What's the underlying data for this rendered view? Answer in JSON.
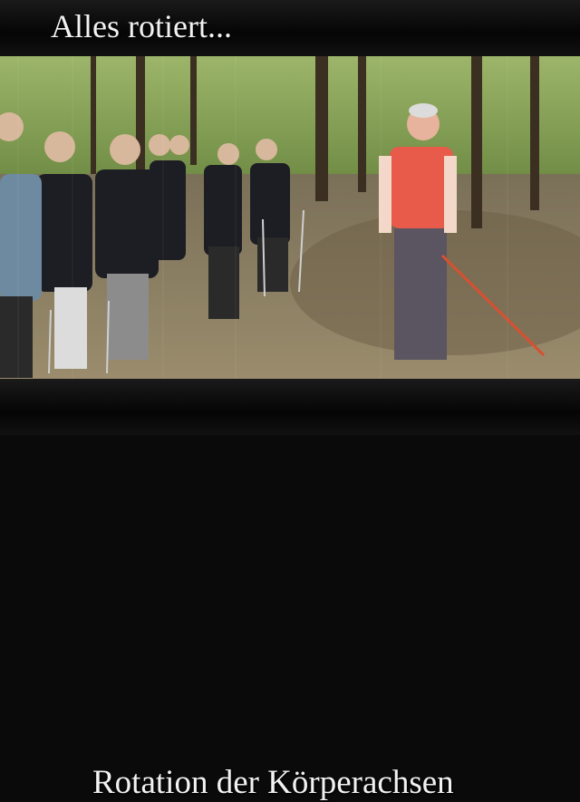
{
  "overlay": {
    "title": "Alles rotiert...",
    "subtitle": "Rotation der Körperachsen"
  },
  "colors": {
    "forest_dark": "#2f3f1c",
    "forest_light": "#8fa85a",
    "path": "#8a7a5e",
    "leader_vest": "#e85a4a"
  }
}
